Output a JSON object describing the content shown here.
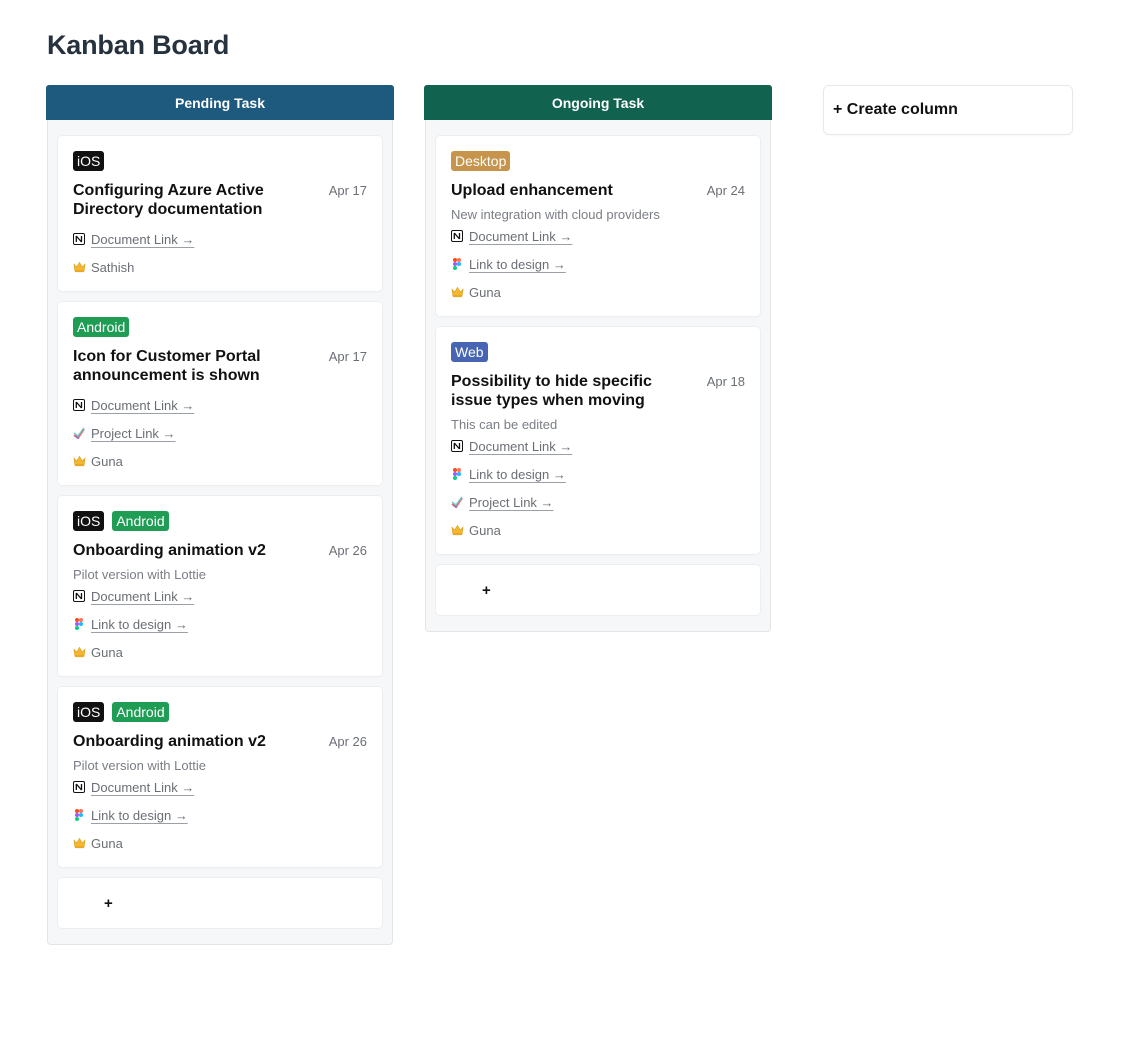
{
  "page": {
    "title": "Kanban Board"
  },
  "colors": {
    "pending_header": "#1d5a7e",
    "ongoing_header": "#11624f",
    "tag_ios": "#111111",
    "tag_android": "#1f9d55",
    "tag_desktop": "#c6944a",
    "tag_web": "#4765b3"
  },
  "columns": [
    {
      "title": "Pending Task",
      "add_label": "+",
      "cards": [
        {
          "tags": [
            {
              "label": "iOS",
              "color": "#111111"
            }
          ],
          "title": "Configuring Azure Active Directory documentation",
          "date": "Apr 17",
          "description": "",
          "links": [
            {
              "icon": "notion-icon",
              "label": "Document Link →"
            }
          ],
          "assignee": {
            "icon": "crown-icon",
            "name": "Sathish"
          }
        },
        {
          "tags": [
            {
              "label": "Android",
              "color": "#1f9d55"
            }
          ],
          "title": "Icon for Customer Portal announcement is shown",
          "date": "Apr 17",
          "description": "",
          "links": [
            {
              "icon": "notion-icon",
              "label": "Document Link →"
            },
            {
              "icon": "project-icon",
              "label": "Project Link →"
            }
          ],
          "assignee": {
            "icon": "crown-icon",
            "name": "Guna"
          }
        },
        {
          "tags": [
            {
              "label": "iOS",
              "color": "#111111"
            },
            {
              "label": "Android",
              "color": "#1f9d55"
            }
          ],
          "title": "Onboarding animation v2",
          "date": "Apr 26",
          "description": "Pilot version with Lottie",
          "links": [
            {
              "icon": "notion-icon",
              "label": "Document Link →"
            },
            {
              "icon": "figma-icon",
              "label": "Link to design →"
            }
          ],
          "assignee": {
            "icon": "crown-icon",
            "name": "Guna"
          }
        },
        {
          "tags": [
            {
              "label": "iOS",
              "color": "#111111"
            },
            {
              "label": "Android",
              "color": "#1f9d55"
            }
          ],
          "title": "Onboarding animation v2",
          "date": "Apr 26",
          "description": "Pilot version with Lottie",
          "links": [
            {
              "icon": "notion-icon",
              "label": "Document Link →"
            },
            {
              "icon": "figma-icon",
              "label": "Link to design →"
            }
          ],
          "assignee": {
            "icon": "crown-icon",
            "name": "Guna"
          }
        }
      ]
    },
    {
      "title": "Ongoing Task",
      "add_label": "+",
      "cards": [
        {
          "tags": [
            {
              "label": "Desktop",
              "color": "#c6944a"
            }
          ],
          "title": "Upload enhancement",
          "date": "Apr 24",
          "description": "New integration with cloud providers",
          "links": [
            {
              "icon": "notion-icon",
              "label": "Document Link →"
            },
            {
              "icon": "figma-icon",
              "label": "Link to design →"
            }
          ],
          "assignee": {
            "icon": "crown-icon",
            "name": "Guna"
          }
        },
        {
          "tags": [
            {
              "label": "Web",
              "color": "#4765b3"
            }
          ],
          "title": "Possibility to hide specific issue types when moving",
          "date": "Apr 18",
          "description": "This can be edited",
          "links": [
            {
              "icon": "notion-icon",
              "label": "Document Link →"
            },
            {
              "icon": "figma-icon",
              "label": "Link to design →"
            },
            {
              "icon": "project-icon",
              "label": "Project Link →"
            }
          ],
          "assignee": {
            "icon": "crown-icon",
            "name": "Guna"
          }
        }
      ]
    }
  ],
  "create_column_label": "+ Create column"
}
